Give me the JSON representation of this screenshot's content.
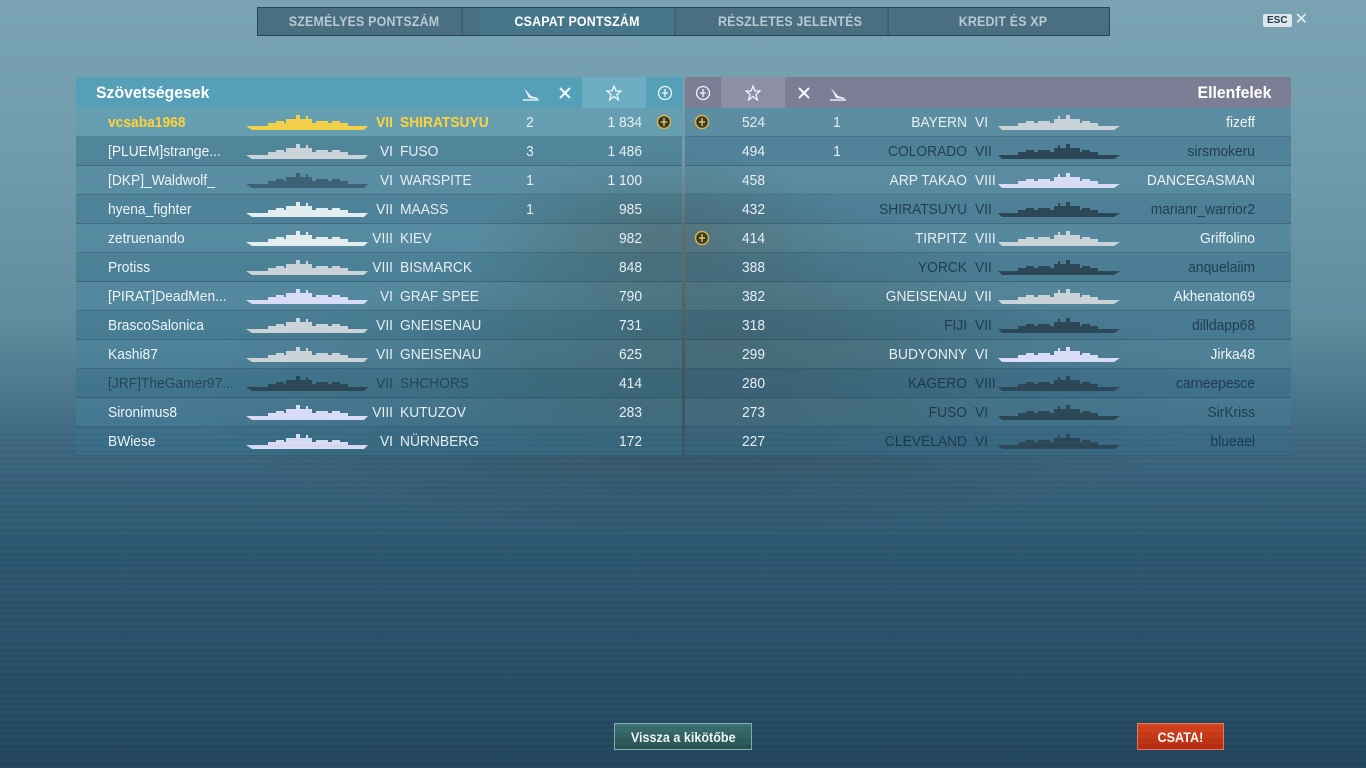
{
  "tabs": [
    {
      "label": "SZEMÉLYES PONTSZÁM",
      "active": false
    },
    {
      "label": "CSAPAT PONTSZÁM",
      "active": true
    },
    {
      "label": "RÉSZLETES JELENTÉS",
      "active": false
    },
    {
      "label": "KREDIT ÉS XP",
      "active": false
    }
  ],
  "esc": {
    "key": "ESC",
    "close": "✕"
  },
  "allies": {
    "title": "Szövetségesek",
    "header_icons": [
      "plane-kills-icon",
      "ship-kills-icon",
      "star-icon",
      "medal-icon"
    ],
    "rows": [
      {
        "player": "vcsaba1968",
        "tier": "VII",
        "ship": "SHIRATSUYU",
        "kills": "2",
        "score": "1 834",
        "medal": true,
        "me": true,
        "dead": false,
        "silhouette_color": "#f2d04a"
      },
      {
        "player": "[PLUEM]strange...",
        "tier": "VI",
        "ship": "FUSO",
        "kills": "3",
        "score": "1 486",
        "medal": false,
        "me": false,
        "dead": false,
        "silhouette_color": "#c9d3d8"
      },
      {
        "player": "[DKP]_Waldwolf_",
        "tier": "VI",
        "ship": "WARSPITE",
        "kills": "1",
        "score": "1 100",
        "medal": false,
        "me": false,
        "dead": false,
        "silhouette_color": "#3d6275"
      },
      {
        "player": "hyena_fighter",
        "tier": "VII",
        "ship": "MAASS",
        "kills": "1",
        "score": "985",
        "medal": false,
        "me": false,
        "dead": false,
        "silhouette_color": "#e3ecef"
      },
      {
        "player": "zetruenando",
        "tier": "VIII",
        "ship": "KIEV",
        "kills": "",
        "score": "982",
        "medal": false,
        "me": false,
        "dead": false,
        "silhouette_color": "#e3ecef"
      },
      {
        "player": "Protiss",
        "tier": "VIII",
        "ship": "BISMARCK",
        "kills": "",
        "score": "848",
        "medal": false,
        "me": false,
        "dead": false,
        "silhouette_color": "#c9d3d8"
      },
      {
        "player": "[PIRAT]DeadMen...",
        "tier": "VI",
        "ship": "GRAF SPEE",
        "kills": "",
        "score": "790",
        "medal": false,
        "me": false,
        "dead": false,
        "silhouette_color": "#d9dcf6"
      },
      {
        "player": "BrascoSalonica",
        "tier": "VII",
        "ship": "GNEISENAU",
        "kills": "",
        "score": "731",
        "medal": false,
        "me": false,
        "dead": false,
        "silhouette_color": "#c9d3d8"
      },
      {
        "player": "Kashi87",
        "tier": "VII",
        "ship": "GNEISENAU",
        "kills": "",
        "score": "625",
        "medal": false,
        "me": false,
        "dead": false,
        "silhouette_color": "#c9d3d8"
      },
      {
        "player": "[JRF]TheGamer97...",
        "tier": "VII",
        "ship": "SHCHORS",
        "kills": "",
        "score": "414",
        "medal": false,
        "me": false,
        "dead": true,
        "silhouette_color": "#2c4756"
      },
      {
        "player": "Sironimus8",
        "tier": "VIII",
        "ship": "KUTUZOV",
        "kills": "",
        "score": "283",
        "medal": false,
        "me": false,
        "dead": false,
        "silhouette_color": "#d9dcf6"
      },
      {
        "player": "BWiese",
        "tier": "VI",
        "ship": "NÜRNBERG",
        "kills": "",
        "score": "172",
        "medal": false,
        "me": false,
        "dead": false,
        "silhouette_color": "#d9dcf6"
      }
    ]
  },
  "enemies": {
    "title": "Ellenfelek",
    "header_icons": [
      "medal-icon",
      "star-icon",
      "ship-kills-icon",
      "plane-kills-icon"
    ],
    "rows": [
      {
        "player": "fizeff",
        "tier": "VI",
        "ship": "BAYERN",
        "kills": "1",
        "score": "524",
        "medal": true,
        "dead": false,
        "silhouette_color": "#c9d3d8"
      },
      {
        "player": "sirsmokeru",
        "tier": "VII",
        "ship": "COLORADO",
        "kills": "1",
        "score": "494",
        "medal": false,
        "dead": true,
        "silhouette_color": "#2c4756"
      },
      {
        "player": "DANCEGASMAN",
        "tier": "VIII",
        "ship": "ARP TAKAO",
        "kills": "",
        "score": "458",
        "medal": false,
        "dead": false,
        "silhouette_color": "#d9dcf6"
      },
      {
        "player": "marianr_warrior2",
        "tier": "VII",
        "ship": "SHIRATSUYU",
        "kills": "",
        "score": "432",
        "medal": false,
        "dead": true,
        "silhouette_color": "#2c4756"
      },
      {
        "player": "Griffolino",
        "tier": "VIII",
        "ship": "TIRPITZ",
        "kills": "",
        "score": "414",
        "medal": true,
        "dead": false,
        "silhouette_color": "#c9d3d8"
      },
      {
        "player": "anquelaiim",
        "tier": "VII",
        "ship": "YORCK",
        "kills": "",
        "score": "388",
        "medal": false,
        "dead": true,
        "silhouette_color": "#2c4756"
      },
      {
        "player": "Akhenaton69",
        "tier": "VII",
        "ship": "GNEISENAU",
        "kills": "",
        "score": "382",
        "medal": false,
        "dead": false,
        "silhouette_color": "#c9d3d8"
      },
      {
        "player": "dilldapp68",
        "tier": "VII",
        "ship": "FIJI",
        "kills": "",
        "score": "318",
        "medal": false,
        "dead": true,
        "silhouette_color": "#2c4756"
      },
      {
        "player": "Jirka48",
        "tier": "VI",
        "ship": "BUDYONNY",
        "kills": "",
        "score": "299",
        "medal": false,
        "dead": false,
        "silhouette_color": "#d9dcf6"
      },
      {
        "player": "carneepesce",
        "tier": "VIII",
        "ship": "KAGERO",
        "kills": "",
        "score": "280",
        "medal": false,
        "dead": true,
        "silhouette_color": "#2c4756"
      },
      {
        "player": "SirKriss",
        "tier": "VI",
        "ship": "FUSO",
        "kills": "",
        "score": "273",
        "medal": false,
        "dead": true,
        "silhouette_color": "#2c4756"
      },
      {
        "player": "blueael",
        "tier": "VI",
        "ship": "CLEVELAND",
        "kills": "",
        "score": "227",
        "medal": false,
        "dead": true,
        "silhouette_color": "#2c4756"
      }
    ]
  },
  "buttons": {
    "port": "Vissza a kikötőbe",
    "battle": "CSATA!"
  },
  "colors": {
    "allies_header": "#50a0b9",
    "enemies_header": "#7d7891",
    "player_highlight": "#ffd23a",
    "battle_button": "#c8391a"
  }
}
